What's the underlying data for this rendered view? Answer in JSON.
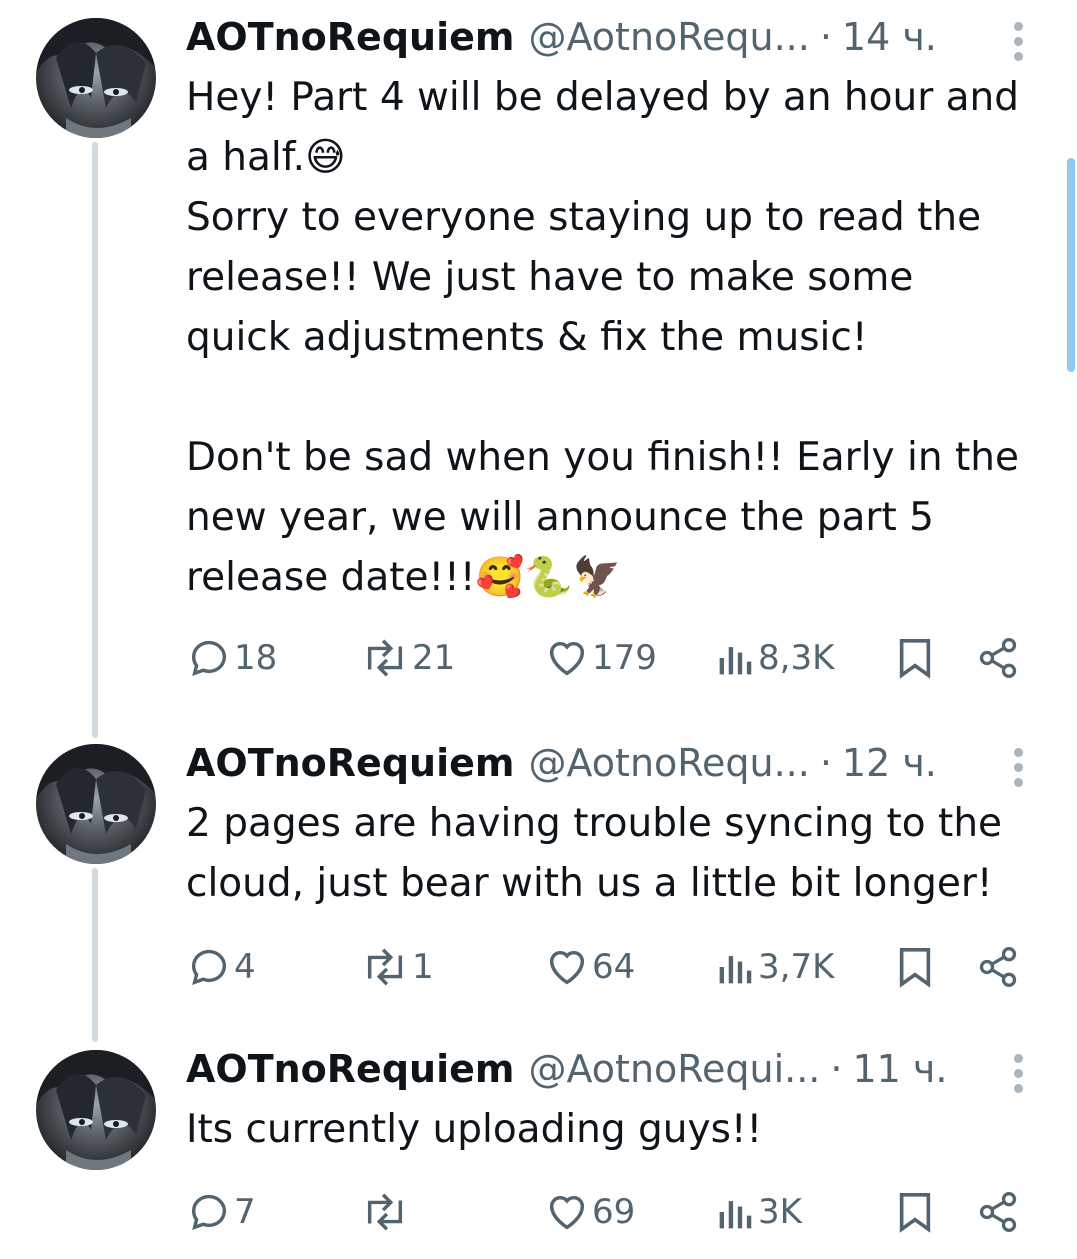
{
  "tweets": [
    {
      "author": "AOTnoRequiem",
      "handle": "@AotnoRequ...",
      "separator": "·",
      "time": "14 ч.",
      "text": "Hey! Part 4 will be delayed by an hour and\na half.😅\nSorry to everyone staying up to read the\nrelease!! We just have to make some\nquick adjustments & fix the music!\n\nDon't be sad when you finish!! Early in the\nnew year, we will announce the part 5\nrelease date!!!🥰🐍🦅",
      "replies": "18",
      "reposts": "21",
      "likes": "179",
      "views": "8,3K"
    },
    {
      "author": "AOTnoRequiem",
      "handle": "@AotnoRequ...",
      "separator": "·",
      "time": "12 ч.",
      "text": "2 pages are having trouble syncing to the\ncloud, just bear with us a little bit longer!",
      "replies": "4",
      "reposts": "1",
      "likes": "64",
      "views": "3,7K"
    },
    {
      "author": "AOTnoRequiem",
      "handle": "@AotnoRequi...",
      "separator": "·",
      "time": "11 ч.",
      "text": "Its currently uploading guys!!",
      "replies": "7",
      "reposts": "",
      "likes": "69",
      "views": "3K"
    }
  ],
  "icons": {
    "reply": "speech-bubble-icon",
    "repost": "repost-arrows-icon",
    "like": "heart-icon",
    "views": "bar-chart-icon",
    "bookmark": "bookmark-icon",
    "share": "share-icon",
    "more": "vertical-dots-icon"
  },
  "colors": {
    "text": "#0f1419",
    "secondary": "#536471",
    "thread_line": "#cfd9de",
    "scrollbar": "#90c8ee"
  }
}
